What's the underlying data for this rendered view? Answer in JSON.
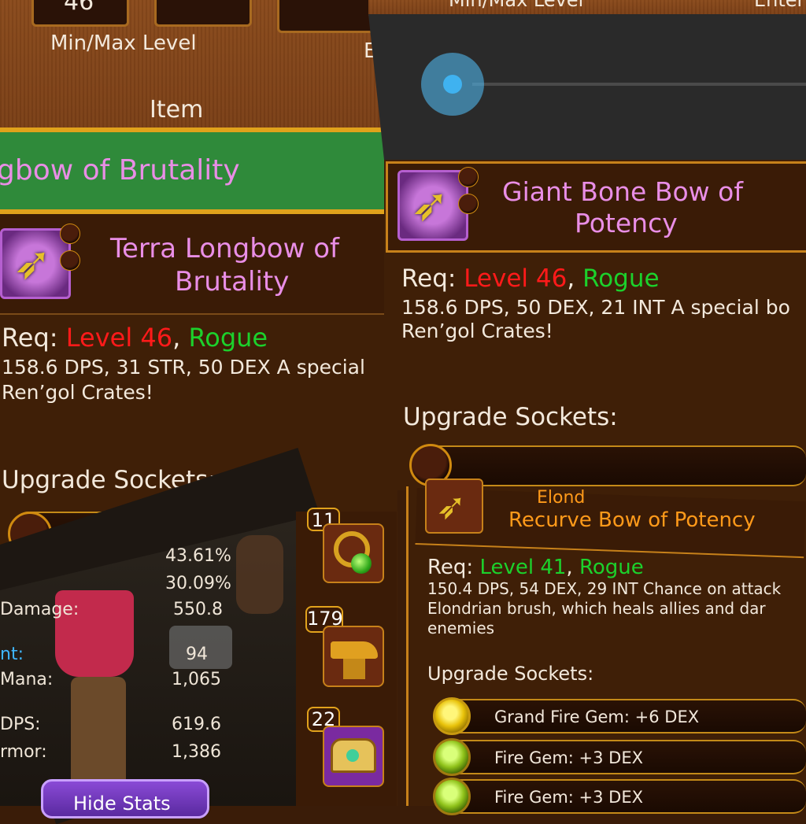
{
  "left_panel": {
    "level_min": "46",
    "minmax_label": "Min/Max Level",
    "extra_label": "E",
    "item_label": "Item",
    "search_value": "gbow of Brutality",
    "item_title_line1": "Terra Longbow of",
    "item_title_line2": "Brutality",
    "req_label": "Req:",
    "req_level": "Level 46",
    "req_sep": ",",
    "req_class": "Rogue",
    "desc_line1": "158.6 DPS, 31 STR, 50 DEX A special",
    "desc_line2": "Ren’gol Crates!",
    "sockets_label": "Upgrade Sockets:"
  },
  "stats_panel": {
    "rows": [
      {
        "label": "",
        "value": "43.61%"
      },
      {
        "label": "",
        "value": "30.09%"
      },
      {
        "label": "Damage:",
        "value": "550.8"
      },
      {
        "label": "nt:",
        "value": "94"
      },
      {
        "label": "Mana:",
        "value": "1,065"
      },
      {
        "label": "DPS:",
        "value": "619.6"
      },
      {
        "label": "rmor:",
        "value": "1,386"
      }
    ],
    "hide_stats_label": "Hide Stats"
  },
  "inventory": [
    {
      "count": "11",
      "icon": "amulet-icon"
    },
    {
      "count": "179",
      "icon": "anvil-icon"
    },
    {
      "count": "22",
      "icon": "treasure-chest-icon"
    }
  ],
  "right_panel": {
    "header_minmax": "Min/Max Level",
    "header_enter": "Enter",
    "item_title_line1": "Giant Bone Bow of",
    "item_title_line2": "Potency",
    "req_label": "Req:",
    "req_level": "Level 46",
    "req_sep": ",",
    "req_class": "Rogue",
    "desc_line1": "158.6 DPS, 50 DEX, 21 INT A special bo",
    "desc_line2": "Ren’gol Crates!",
    "sockets_label": "Upgrade Sockets:"
  },
  "bottom_right_panel": {
    "title_partial": "Elond",
    "title": "Recurve Bow of Potency",
    "req_label": "Req:",
    "req_level": "Level 41",
    "req_sep": ",",
    "req_class": "Rogue",
    "desc_line1": "150.4 DPS, 54 DEX, 29 INT Chance on attack",
    "desc_line2": "Elondrian brush, which heals allies and dar",
    "desc_line3": "enemies",
    "sockets_label": "Upgrade Sockets:",
    "gems": [
      {
        "name": "Grand Fire Gem: +6 DEX",
        "color": "yellow"
      },
      {
        "name": "Fire Gem: +3 DEX",
        "color": "green"
      },
      {
        "name": "Fire Gem: +3 DEX",
        "color": "green"
      }
    ]
  },
  "colors": {
    "accent_gold": "#e0a21b",
    "level_red": "#ff1a1a",
    "class_green": "#1cd12c",
    "title_pink": "#e98ee6",
    "title_orange": "#ff9a1a"
  }
}
